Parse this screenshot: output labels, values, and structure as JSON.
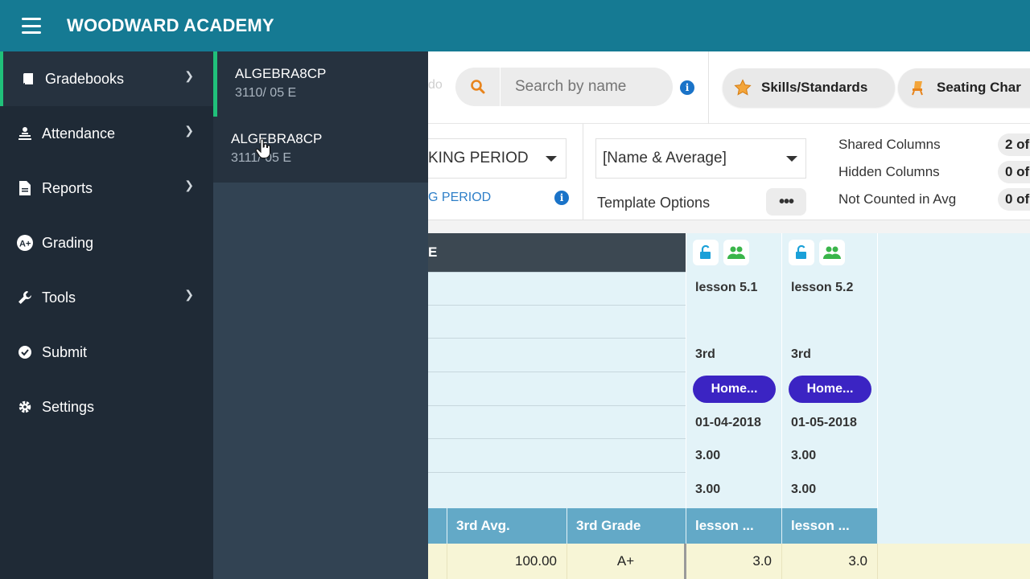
{
  "app": {
    "title": "WOODWARD ACADEMY"
  },
  "sidebar": {
    "items": [
      {
        "label": "Gradebooks",
        "icon": "book-icon",
        "has_submenu": true,
        "active": true
      },
      {
        "label": "Attendance",
        "icon": "attendance-icon",
        "has_submenu": true
      },
      {
        "label": "Reports",
        "icon": "report-icon",
        "has_submenu": true
      },
      {
        "label": "Grading",
        "icon": "grade-a-plus-icon",
        "has_submenu": false
      },
      {
        "label": "Tools",
        "icon": "wrench-icon",
        "has_submenu": true
      },
      {
        "label": "Submit",
        "icon": "check-circle-icon",
        "has_submenu": false
      },
      {
        "label": "Settings",
        "icon": "gear-icon",
        "has_submenu": false
      }
    ]
  },
  "submenu": {
    "items": [
      {
        "name": "ALGEBRA8CP",
        "section": "3110/ 05 E",
        "active": true
      },
      {
        "name": "ALGEBRA8CP",
        "section": "3111/ 05 E"
      }
    ]
  },
  "toolbar": {
    "fragment": "do",
    "search_placeholder": "Search by name",
    "skills_label": "Skills/Standards",
    "seating_label": "Seating Char"
  },
  "options": {
    "period_value": "KING PERIOD",
    "period_link": "G PERIOD",
    "template_value": "[Name & Average]",
    "template_label": "Template Options",
    "stats": [
      {
        "label": "Shared Columns",
        "value": "2 of"
      },
      {
        "label": "Hidden Columns",
        "value": "0 of"
      },
      {
        "label": "Not Counted in Avg",
        "value": "0 of"
      }
    ]
  },
  "grid": {
    "header_left": "E",
    "assignments": [
      {
        "name": "lesson 5.1",
        "period": "3rd",
        "category": "Home...",
        "date": "01-04-2018",
        "points": "3.00",
        "weight": "3.00"
      },
      {
        "name": "lesson 5.2",
        "period": "3rd",
        "category": "Home...",
        "date": "01-05-2018",
        "points": "3.00",
        "weight": "3.00"
      }
    ],
    "band": {
      "avg": "3rd Avg.",
      "grade": "3rd Grade",
      "l1": "lesson ...",
      "l2": "lesson ..."
    },
    "row": {
      "avg": "100.00",
      "grade": "A+",
      "s1": "3.0",
      "s2": "3.0"
    }
  },
  "colors": {
    "topbar": "#157a93",
    "sidebar": "#1f2a36",
    "accent_green": "#20c07a",
    "category_button": "#3b24c3",
    "band": "#63a9c7"
  }
}
